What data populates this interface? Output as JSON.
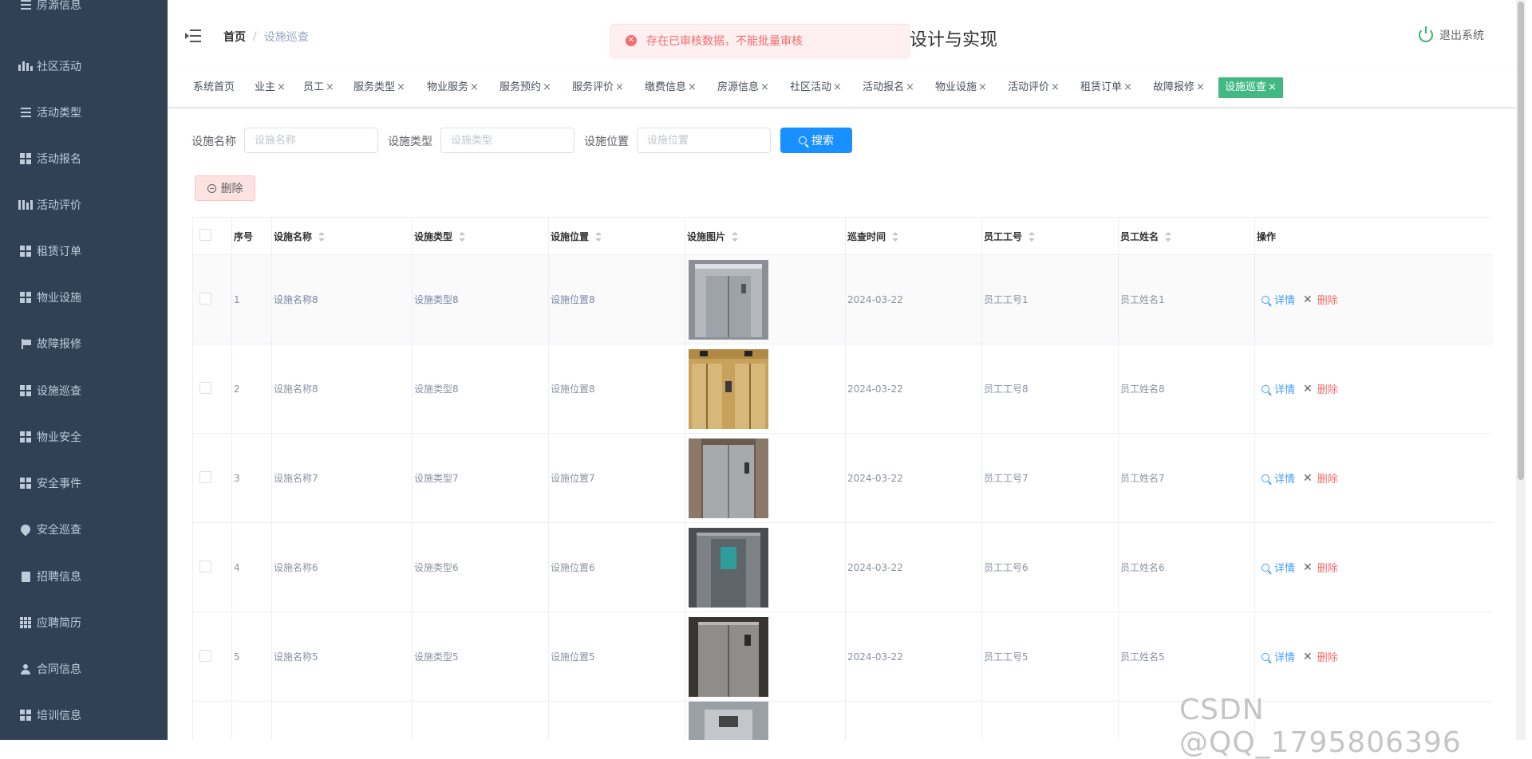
{
  "sidebar": {
    "items": [
      {
        "label": "社区活动",
        "icon": "activity-icon"
      },
      {
        "label": "活动类型",
        "icon": "list-icon"
      },
      {
        "label": "活动报名",
        "icon": "grid-icon"
      },
      {
        "label": "活动评价",
        "icon": "bars-icon"
      },
      {
        "label": "租赁订单",
        "icon": "grid-icon"
      },
      {
        "label": "物业设施",
        "icon": "grid-icon"
      },
      {
        "label": "故障报修",
        "icon": "flag-icon"
      },
      {
        "label": "设施巡查",
        "icon": "grid-icon"
      },
      {
        "label": "物业安全",
        "icon": "grid-icon"
      },
      {
        "label": "安全事件",
        "icon": "grid-icon"
      },
      {
        "label": "安全巡查",
        "icon": "pin-icon"
      },
      {
        "label": "招聘信息",
        "icon": "doc-icon"
      },
      {
        "label": "应聘简历",
        "icon": "grid3-icon"
      },
      {
        "label": "合同信息",
        "icon": "user-icon"
      },
      {
        "label": "培训信息",
        "icon": "grid-icon"
      }
    ]
  },
  "header": {
    "breadcrumb_home": "首页",
    "breadcrumb_current": "设施巡查",
    "system_title": "设计与实现",
    "logout_label": "退出系统"
  },
  "toast": {
    "message": "存在已审核数据，不能批量审核"
  },
  "tags": [
    {
      "label": "系统首页",
      "closable": false
    },
    {
      "label": "业主",
      "closable": true
    },
    {
      "label": "员工",
      "closable": true
    },
    {
      "label": "服务类型",
      "closable": true
    },
    {
      "label": "物业服务",
      "closable": true
    },
    {
      "label": "服务预约",
      "closable": true
    },
    {
      "label": "服务评价",
      "closable": true
    },
    {
      "label": "缴费信息",
      "closable": true
    },
    {
      "label": "房源信息",
      "closable": true
    },
    {
      "label": "社区活动",
      "closable": true
    },
    {
      "label": "活动报名",
      "closable": true
    },
    {
      "label": "物业设施",
      "closable": true
    },
    {
      "label": "活动评价",
      "closable": true
    },
    {
      "label": "租赁订单",
      "closable": true
    },
    {
      "label": "故障报修",
      "closable": true
    },
    {
      "label": "设施巡查",
      "closable": true,
      "active": true
    }
  ],
  "search": {
    "name_label": "设施名称",
    "name_placeholder": "设施名称",
    "type_label": "设施类型",
    "type_placeholder": "设施类型",
    "location_label": "设施位置",
    "location_placeholder": "设施位置",
    "search_button": "搜索"
  },
  "actions": {
    "delete_button": "删除"
  },
  "table": {
    "columns": [
      "序号",
      "设施名称",
      "设施类型",
      "设施位置",
      "设施图片",
      "巡查时间",
      "员工工号",
      "员工姓名",
      "操作"
    ],
    "rows": [
      {
        "index": "1",
        "name": "设施名称8",
        "type": "设施类型8",
        "location": "设施位置8",
        "time": "2024-03-22",
        "emp_no": "员工工号1",
        "emp_name": "员工姓名1"
      },
      {
        "index": "2",
        "name": "设施名称8",
        "type": "设施类型8",
        "location": "设施位置8",
        "time": "2024-03-22",
        "emp_no": "员工工号8",
        "emp_name": "员工姓名8"
      },
      {
        "index": "3",
        "name": "设施名称7",
        "type": "设施类型7",
        "location": "设施位置7",
        "time": "2024-03-22",
        "emp_no": "员工工号7",
        "emp_name": "员工姓名7"
      },
      {
        "index": "4",
        "name": "设施名称6",
        "type": "设施类型6",
        "location": "设施位置6",
        "time": "2024-03-22",
        "emp_no": "员工工号6",
        "emp_name": "员工姓名6"
      },
      {
        "index": "5",
        "name": "设施名称5",
        "type": "设施类型5",
        "location": "设施位置5",
        "time": "2024-03-22",
        "emp_no": "员工工号5",
        "emp_name": "员工姓名5"
      }
    ],
    "detail_label": "详情",
    "delete_label": "删除"
  },
  "watermark": "CSDN @QQ_1795806396",
  "colors": {
    "sidebar_bg": "#304156",
    "active_tag": "#42b983",
    "primary": "#1890ff",
    "danger": "#f56c6c"
  }
}
